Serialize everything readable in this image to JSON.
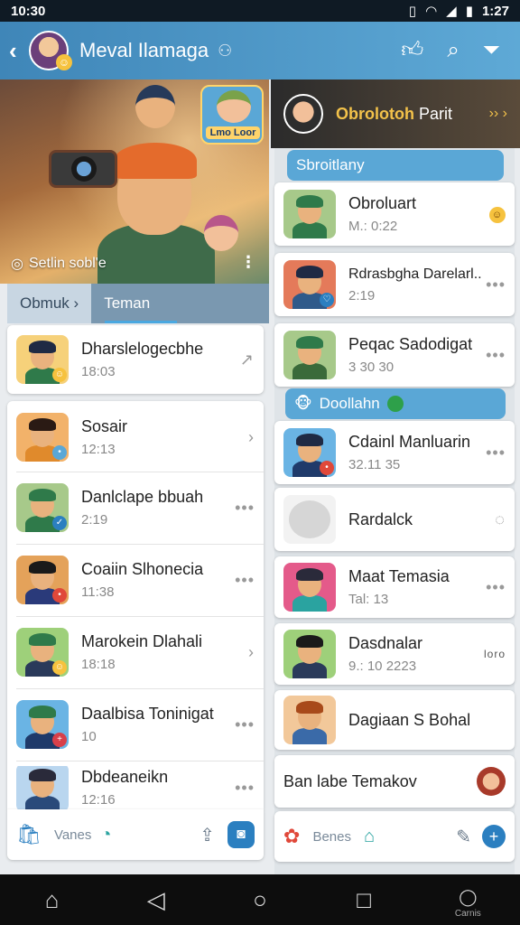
{
  "status": {
    "time_left": "10:30",
    "time_right": "1:27"
  },
  "app_bar": {
    "title": "Meval Ilamaga",
    "title_icon": "⚇"
  },
  "hero": {
    "badge_label": "Lmo Loor",
    "caption": "Setlin sobl'e"
  },
  "tabs": [
    {
      "label": "Obmuk ›"
    },
    {
      "label": "Teman"
    }
  ],
  "left_items": [
    {
      "name": "Dharslelogecbhe",
      "sub": "18:03",
      "action": "↗",
      "hair": "#1f2a44",
      "shirt": "#2f7a4a",
      "bg": "#f6d17a",
      "mini": "#f6c23e"
    },
    {
      "name": "Sosair",
      "sub": "12:13",
      "action": "›",
      "hair": "#2a1a14",
      "shirt": "#e08a2c",
      "bg": "#f2b26a",
      "mini": "#5aa7d6"
    },
    {
      "name": "Danlclape bbuah",
      "sub": "2:19",
      "action": "•••",
      "hair": "#2f7a4a",
      "shirt": "#2f7a4a",
      "bg": "#a7c98a",
      "mini": "#2b7fc0"
    },
    {
      "name": "Coaiin Slhonecia",
      "sub": "11:38",
      "action": "•••",
      "hair": "#1a1a1a",
      "shirt": "#2a3a7a",
      "bg": "#e4a25a",
      "mini": "#e0483a"
    },
    {
      "name": "Marokein Dlahali",
      "sub": "18:18",
      "action": "›",
      "hair": "#2f7a4a",
      "shirt": "#2a3a5a",
      "bg": "#9ed07a",
      "mini": "#f6c23e"
    },
    {
      "name": "Daalbisa Toninigat",
      "sub": "10",
      "action": "•••",
      "hair": "#2f7a4a",
      "shirt": "#1f3a6a",
      "bg": "#6ab4e4",
      "mini": "#d8404a"
    },
    {
      "name": "Dbdeaneikn",
      "sub": "12:16",
      "action": "•••",
      "hair": "#2a2a3a",
      "shirt": "#2a4a7a",
      "bg": "#b9d6ef",
      "mini": "#5aa7d6"
    }
  ],
  "left_bottom": {
    "label": "Vanes"
  },
  "right_header": {
    "title_a": "Obrolotoh",
    "title_b": "Parit",
    "chevron": "›› ›"
  },
  "right_sections": [
    {
      "label": "Sbroitlany"
    },
    {
      "label": "Doollahn"
    }
  ],
  "right_items": [
    {
      "name": "Obroluart",
      "sub": "M.: 0:22",
      "action": "☺",
      "hair": "#2f7a4a",
      "shirt": "#2f7a4a",
      "bg": "#a7c98a"
    },
    {
      "name": "Rdrasbgha Darelarl..",
      "sub": "2:19",
      "action": "•••",
      "hair": "#1f2a44",
      "shirt": "#2f5a8a",
      "bg": "#e47a5a"
    },
    {
      "name": "Peqac Sadodigat",
      "sub": "3 30 30",
      "action": "•••",
      "hair": "#2f7a4a",
      "shirt": "#3a6a3a",
      "bg": "#a7c98a"
    },
    {
      "name": "Cdainl Manluarin",
      "sub": "32.11 35",
      "action": "•••",
      "hair": "#1f2a44",
      "shirt": "#1f3a6a",
      "bg": "#6ab4e4"
    },
    {
      "name": "Rardalck",
      "sub": "",
      "action": "◌",
      "hair": "#cfcfcf",
      "shirt": "#cfcfcf",
      "bg": "#f2f2f2"
    },
    {
      "name": "Maat Temasia",
      "sub": "Tal: 13",
      "action": "•••",
      "hair": "#2a2a3a",
      "shirt": "#2aa3a0",
      "bg": "#e45a8a"
    },
    {
      "name": "Dasdnalar",
      "sub": "9.: 10 2223",
      "action": "loro",
      "hair": "#1a1a1a",
      "shirt": "#2a3a5a",
      "bg": "#9ed07a"
    },
    {
      "name": "Dagiaan S Bohal",
      "sub": "",
      "action": "",
      "hair": "#a84a1a",
      "shirt": "#3a6aa8",
      "bg": "#f2c89a"
    }
  ],
  "right_last": {
    "name": "Ban labe Temakov"
  },
  "right_bottom": {
    "label": "Benes"
  },
  "nav": {
    "recents_label": "Carnis"
  }
}
